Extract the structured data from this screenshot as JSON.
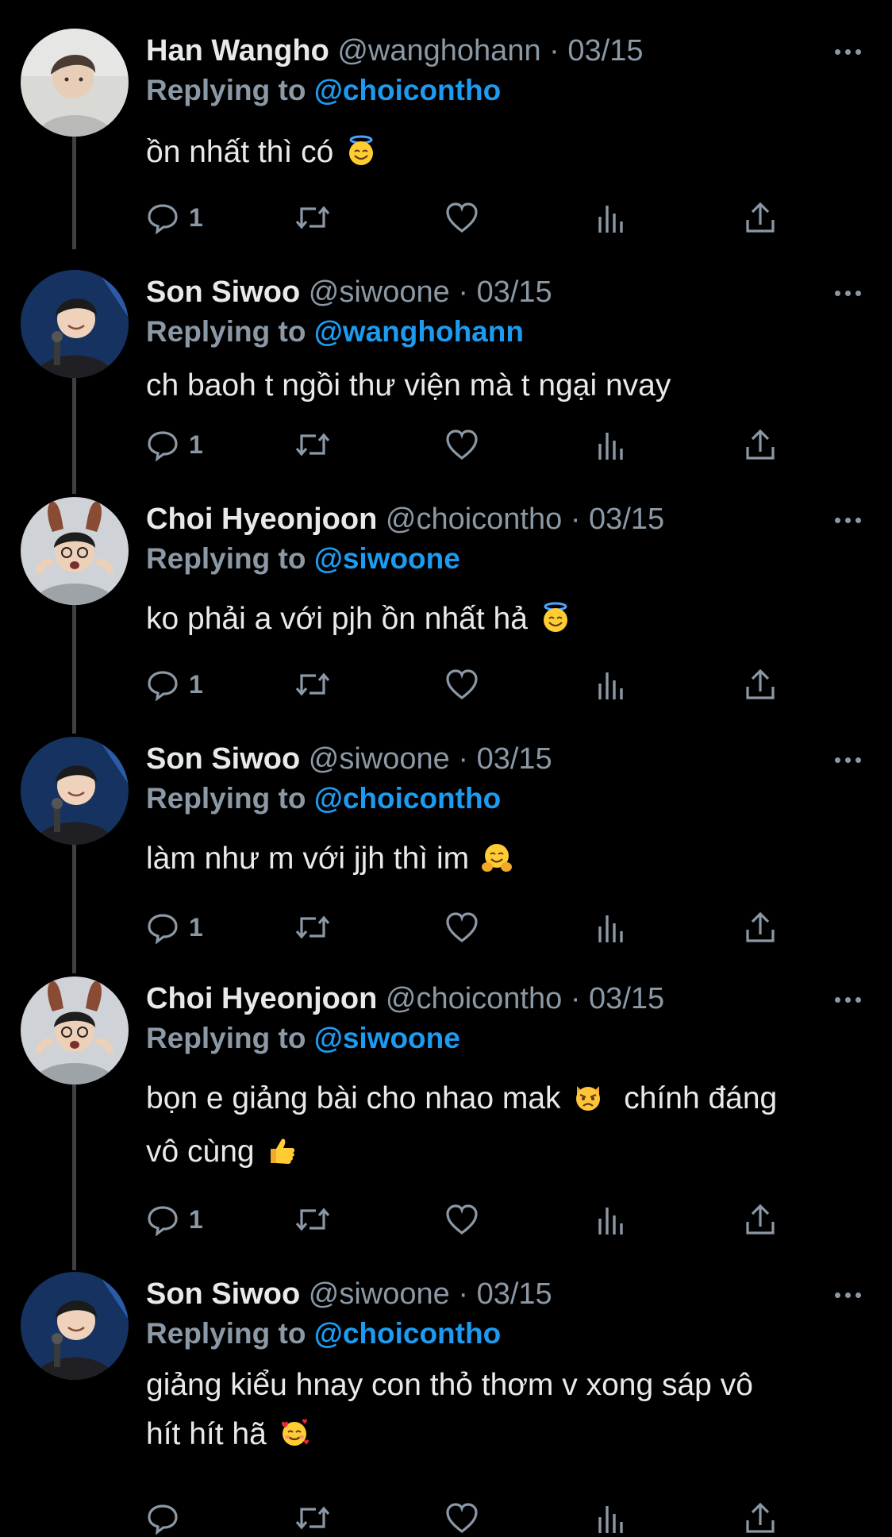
{
  "thread": [
    {
      "display_name": "Han Wangho",
      "handle": "@wanghohann",
      "dot": "·",
      "date": "03/15",
      "replying_label": "Replying to",
      "reply_to": "@choicontho",
      "text": "ồn nhất thì có",
      "emoji": "smiling-face-with-halo",
      "reply_count": "1",
      "avatar": "han-wangho-avatar"
    },
    {
      "display_name": "Son Siwoo",
      "handle": "@siwoone",
      "dot": "·",
      "date": "03/15",
      "replying_label": "Replying to",
      "reply_to": "@wanghohann",
      "text": "ch baoh t ngồi thư viện mà t ngại nvay",
      "emoji": "",
      "reply_count": "1",
      "avatar": "son-siwoo-avatar"
    },
    {
      "display_name": "Choi Hyeonjoon",
      "handle": "@choicontho",
      "dot": "·",
      "date": "03/15",
      "replying_label": "Replying to",
      "reply_to": "@siwoone",
      "text": "ko phải a với pjh ồn nhất hả",
      "emoji": "smiling-face-with-halo",
      "reply_count": "1",
      "avatar": "choi-hyeonjoon-avatar"
    },
    {
      "display_name": "Son Siwoo",
      "handle": "@siwoone",
      "dot": "·",
      "date": "03/15",
      "replying_label": "Replying to",
      "reply_to": "@choicontho",
      "text": "làm như m với jjh thì im",
      "emoji": "hugging-face",
      "reply_count": "1",
      "avatar": "son-siwoo-avatar"
    },
    {
      "display_name": "Choi Hyeonjoon",
      "handle": "@choicontho",
      "dot": "·",
      "date": "03/15",
      "replying_label": "Replying to",
      "reply_to": "@siwoone",
      "text_line1": "bọn e giảng bài cho nhao mak",
      "text_line1_after": "chính đáng",
      "text_line2": "vô cùng",
      "emoji": "pouting-cat",
      "emoji2": "thumbs-up",
      "reply_count": "1",
      "avatar": "choi-hyeonjoon-avatar"
    },
    {
      "display_name": "Son Siwoo",
      "handle": "@siwoone",
      "dot": "·",
      "date": "03/15",
      "replying_label": "Replying to",
      "reply_to": "@choicontho",
      "text_line1": "giảng kiểu hnay con thỏ thơm v xong sáp vô",
      "text_line2": "hít hít hã",
      "emoji": "smiling-face-with-hearts",
      "reply_count": "",
      "avatar": "son-siwoo-avatar"
    }
  ],
  "icons": {
    "reply": "reply-icon",
    "retweet": "retweet-icon",
    "like": "heart-icon",
    "views": "views-icon",
    "share": "share-icon",
    "more": "more-icon"
  },
  "colors": {
    "background": "#000000",
    "text": "#e7e9ea",
    "secondary": "#8b98a5",
    "mention": "#1d9bf0",
    "thread_line": "#3e4144"
  }
}
